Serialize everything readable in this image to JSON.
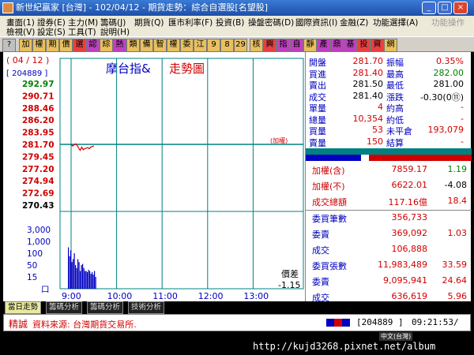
{
  "window": {
    "title": "新世紀贏家 [台灣] - 102/04/12 - 期貨走勢：綜合自選股[名望股]",
    "min_glyph": "_",
    "max_glyph": "□",
    "close_glyph": "×"
  },
  "menu": {
    "row1": [
      "畫面(1)",
      "證券(E)",
      "主力(M)",
      "籌碼(J)",
      "期貨(Q)",
      "匯市利率(F)",
      "投資(B)",
      "操盤密碼(D)",
      "國際資訊(I)",
      "金融(Z)",
      "功能選擇(A)"
    ],
    "row1_right": "功能操作",
    "row2": [
      "檢視(V)",
      "設定(S)",
      "工具(T)",
      "說明(H)"
    ]
  },
  "toolbar": {
    "buttons": [
      "?",
      "加",
      "權",
      "期",
      "價",
      "選",
      "認",
      "綜",
      "熱",
      "類",
      "備",
      "智",
      "權",
      "委",
      "江",
      "9",
      "8",
      "29",
      "核",
      "興",
      "指",
      "自",
      "靜",
      "產",
      "鼎",
      "基",
      "投",
      "資",
      "網"
    ],
    "colors": [
      "#c0c0c0",
      "#e8c060",
      "#e8c060",
      "#e8c060",
      "#e8c060",
      "#e84040",
      "#c040c0",
      "#e8c060",
      "#c040c0",
      "#e8c060",
      "#e8c060",
      "#e8c060",
      "#e8c060",
      "#e8c060",
      "#e8c060",
      "#e8c060",
      "#e8c060",
      "#e8c060",
      "#e8c060",
      "#e84040",
      "#c040c0",
      "#c040c0",
      "#e8c060",
      "#c040c0",
      "#c040c0",
      "#c040c0",
      "#e84040",
      "#e84040",
      "#e8c060"
    ]
  },
  "chart": {
    "date_badge": "( 04 / 12 )",
    "code_badge": "[ 204889 ]",
    "title_blue": "摩台指&",
    "title_red": "走勢圖",
    "ref_tag": "(加權)",
    "price_diff_label": "價差",
    "price_diff_value": "-1.15"
  },
  "chart_data": {
    "type": "line",
    "price_ticks": [
      "292.97",
      "290.71",
      "288.46",
      "286.20",
      "283.95",
      "281.70",
      "279.45",
      "277.20",
      "274.94",
      "272.69",
      "270.43"
    ],
    "price_tick_colors": [
      "#008000",
      "#d00000",
      "#d00000",
      "#d00000",
      "#d00000",
      "#d00000",
      "#d00000",
      "#d00000",
      "#d00000",
      "#d00000",
      "#000000"
    ],
    "y_range": [
      270.43,
      292.97
    ],
    "reference_price": 281.7,
    "time_labels": [
      "9:00",
      "10:00",
      "11:00",
      "12:00",
      "13:00"
    ],
    "session_minutes": 300,
    "price_series": {
      "t": [
        0,
        2,
        4,
        6,
        8,
        10,
        12,
        14,
        16,
        18,
        20,
        22,
        24,
        26,
        28,
        30
      ],
      "v": [
        281.7,
        281.4,
        281.6,
        281.8,
        281.5,
        281.0,
        280.6,
        281.2,
        280.7,
        280.9,
        281.0,
        281.1,
        280.9,
        281.2,
        281.3,
        281.4
      ]
    },
    "volume_ticks": [
      "3,000",
      "1,000",
      "100",
      "50",
      "15",
      "口"
    ],
    "volume_bars": [
      0.7,
      0.55,
      0.65,
      0.45,
      0.5,
      0.6,
      0.4,
      0.35,
      0.5,
      0.45,
      0.3,
      0.4,
      0.42,
      0.35,
      0.3,
      0.3,
      0.28,
      0.32,
      0.3,
      0.25,
      0.28,
      0.24,
      0.3,
      0.2
    ]
  },
  "quote": [
    {
      "l1": "開盤",
      "v1": "281.70",
      "c1": "#d00000",
      "l2": "振幅",
      "v2": "0.35%",
      "c2": "#d00000"
    },
    {
      "l1": "買進",
      "v1": "281.40",
      "c1": "#d00000",
      "l2": "最高",
      "v2": "282.00",
      "c2": "#008000"
    },
    {
      "l1": "賣出",
      "v1": "281.50",
      "c1": "#000000",
      "l2": "最低",
      "v2": "281.00",
      "c2": "#000000"
    },
    {
      "l1": "成交",
      "v1": "281.40",
      "c1": "#000000",
      "l2": "漲跌",
      "v2": "-0.30(0⑪)",
      "c2": "#000000"
    },
    {
      "l1": "單量",
      "v1": "4",
      "c1": "#d00000",
      "l2": "約高",
      "v2": "-",
      "c2": "#d00000"
    },
    {
      "l1": "總量",
      "v1": "10,354",
      "c1": "#d00000",
      "l2": "約低",
      "v2": "-",
      "c2": "#d00000"
    },
    {
      "l1": "買量",
      "v1": "53",
      "c1": "#d00000",
      "l2": "未平倉",
      "v2": "193,079",
      "c2": "#d00000"
    },
    {
      "l1": "賣量",
      "v1": "150",
      "c1": "#d00000",
      "l2": "結算",
      "v2": "-",
      "c2": "#d00000"
    }
  ],
  "index": [
    {
      "label": "加權(含)",
      "value": "7859.17",
      "vcolor": "#d00000",
      "change": "1.19",
      "ccolor": "#008000"
    },
    {
      "label": "加權(不)",
      "value": "6622.01",
      "vcolor": "#d00000",
      "change": "-4.08",
      "ccolor": "#000000"
    },
    {
      "label": "成交總額",
      "value": "117.16億",
      "vcolor": "#d00000",
      "change": "18.4",
      "ccolor": "#d00000"
    }
  ],
  "orders": [
    {
      "label": "委買筆數",
      "value": "356,733",
      "change": ""
    },
    {
      "label": "委賣",
      "value": "369,092",
      "change": "1.03"
    },
    {
      "label": "成交",
      "value": "106,888",
      "change": ""
    },
    {
      "label": "委買張數",
      "value": "11,983,489",
      "change": "33.59"
    },
    {
      "label": "委賣",
      "value": "9,095,941",
      "change": "24.64"
    },
    {
      "label": "成交",
      "value": "636,619",
      "change": "5.96"
    }
  ],
  "tabs": [
    "當日走勢",
    "籌碼分析",
    "籌碼分析",
    "技術分析"
  ],
  "status": {
    "label": "精誠",
    "source": "資料來源: 台灣期貨交易所.",
    "code": "[204889 ]",
    "time": "09:21:53/"
  },
  "watermark": {
    "ime": "中文(台灣)",
    "url": "http://kujd3268.pixnet.net/album"
  }
}
